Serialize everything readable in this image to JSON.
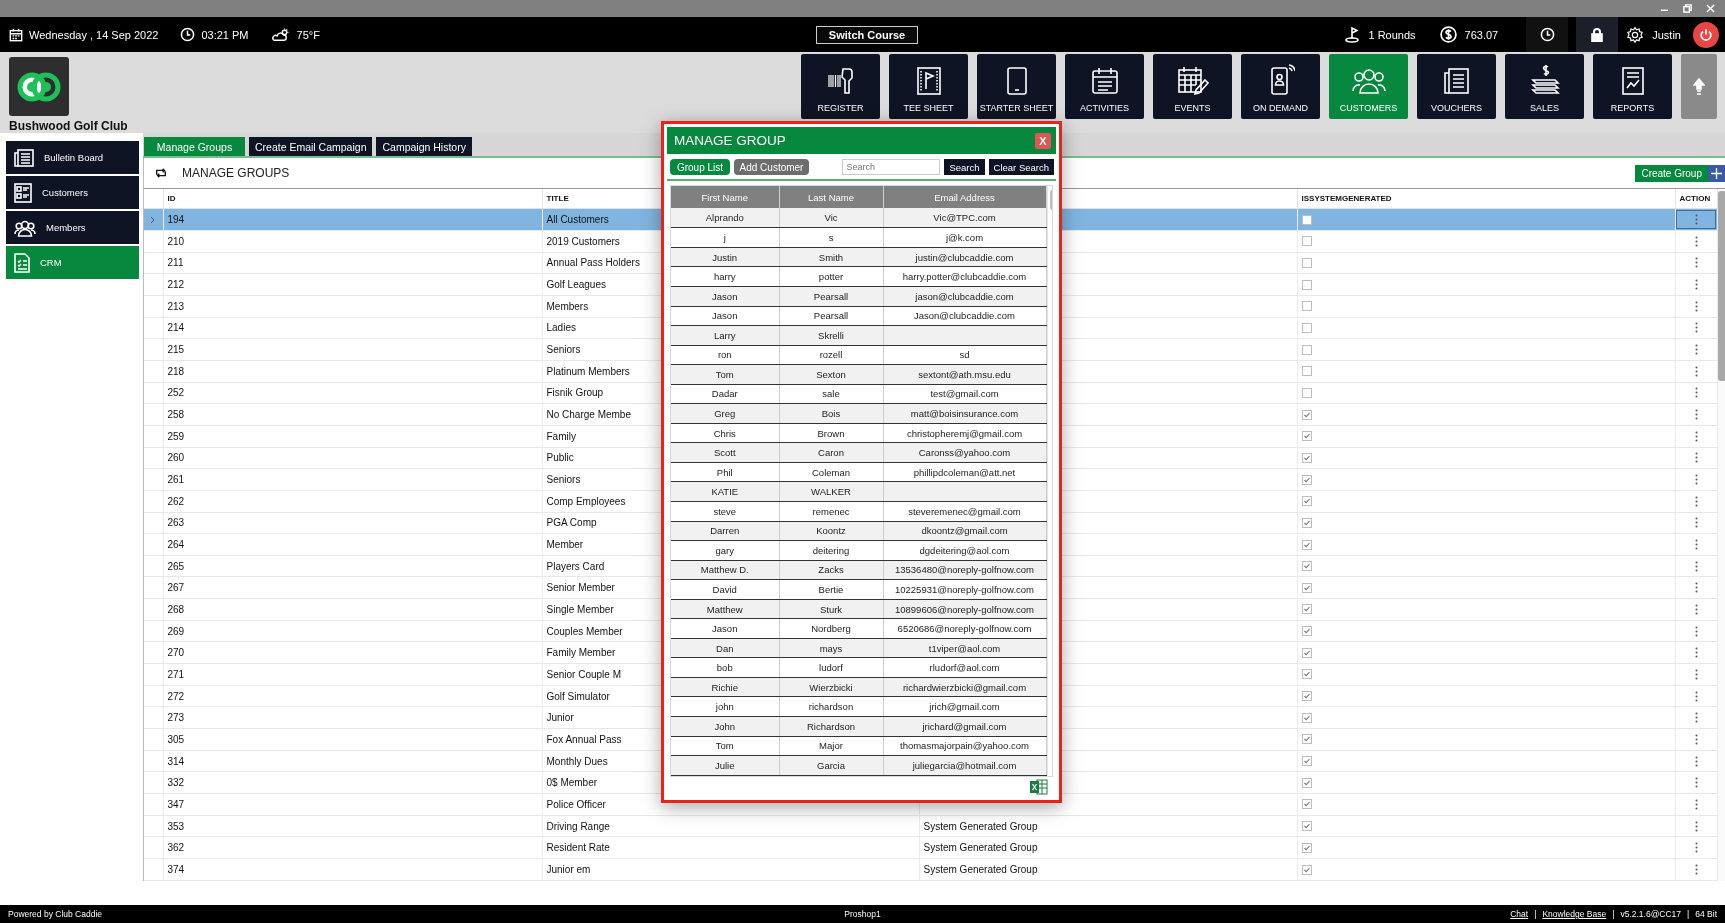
{
  "top_bar": {
    "date": "Wednesday ,  14 Sep 2022",
    "time": "03:21 PM",
    "weather": "75°F",
    "switch_course": "Switch Course",
    "rounds": "1 Rounds",
    "balance": "763.07",
    "user": "Justin"
  },
  "club": {
    "name": "Bushwood Golf Club"
  },
  "nav_tiles": [
    {
      "label": "REGISTER",
      "selected": false
    },
    {
      "label": "TEE SHEET",
      "selected": false
    },
    {
      "label": "STARTER SHEET",
      "selected": false
    },
    {
      "label": "ACTIVITIES",
      "selected": false
    },
    {
      "label": "EVENTS",
      "selected": false
    },
    {
      "label": "ON DEMAND",
      "selected": false
    },
    {
      "label": "CUSTOMERS",
      "selected": true
    },
    {
      "label": "VOUCHERS",
      "selected": false
    },
    {
      "label": "SALES",
      "selected": false
    },
    {
      "label": "REPORTS",
      "selected": false
    }
  ],
  "sidebar": {
    "items": [
      {
        "label": "Bulletin Board",
        "selected": false
      },
      {
        "label": "Customers",
        "selected": false
      },
      {
        "label": "Members",
        "selected": false
      },
      {
        "label": "CRM",
        "selected": true
      }
    ]
  },
  "tabs": [
    {
      "label": "Manage Groups",
      "selected": true
    },
    {
      "label": "Create Email Campaign",
      "selected": false
    },
    {
      "label": "Campaign History",
      "selected": false
    }
  ],
  "content": {
    "title": "MANAGE GROUPS",
    "create_button": "Create Group"
  },
  "table": {
    "columns": [
      "ID",
      "TITLE",
      "ISSYSTEMGENERATED",
      "ACTION"
    ],
    "rows": [
      {
        "id": "194",
        "title": "All Customers",
        "system_generated": false,
        "selected": true
      },
      {
        "id": "210",
        "title": "2019 Customers",
        "system_generated": false,
        "selected": false
      },
      {
        "id": "211",
        "title": "Annual Pass Holders",
        "system_generated": false,
        "selected": false
      },
      {
        "id": "212",
        "title": "Golf Leagues",
        "system_generated": false,
        "selected": false
      },
      {
        "id": "213",
        "title": "Members",
        "system_generated": false,
        "selected": false
      },
      {
        "id": "214",
        "title": "Ladies",
        "system_generated": false,
        "selected": false
      },
      {
        "id": "215",
        "title": "Seniors",
        "system_generated": false,
        "selected": false
      },
      {
        "id": "218",
        "title": "Platinum Members",
        "system_generated": false,
        "selected": false
      },
      {
        "id": "252",
        "title": "Fisnik Group",
        "system_generated": false,
        "selected": false
      },
      {
        "id": "258",
        "title": "No Charge Membe",
        "system_generated": true,
        "selected": false
      },
      {
        "id": "259",
        "title": "Family",
        "system_generated": true,
        "selected": false
      },
      {
        "id": "260",
        "title": "Public",
        "system_generated": true,
        "selected": false
      },
      {
        "id": "261",
        "title": "Seniors",
        "system_generated": true,
        "selected": false
      },
      {
        "id": "262",
        "title": "Comp Employees",
        "system_generated": true,
        "selected": false
      },
      {
        "id": "263",
        "title": "PGA Comp",
        "system_generated": true,
        "selected": false
      },
      {
        "id": "264",
        "title": "Member",
        "system_generated": true,
        "selected": false
      },
      {
        "id": "265",
        "title": "Players Card",
        "system_generated": true,
        "selected": false
      },
      {
        "id": "267",
        "title": "Senior Member",
        "system_generated": true,
        "selected": false
      },
      {
        "id": "268",
        "title": "Single Member",
        "system_generated": true,
        "selected": false
      },
      {
        "id": "269",
        "title": "Couples Member",
        "system_generated": true,
        "selected": false
      },
      {
        "id": "270",
        "title": "Family Member",
        "system_generated": true,
        "selected": false
      },
      {
        "id": "271",
        "title": "Senior Couple M",
        "system_generated": true,
        "selected": false
      },
      {
        "id": "272",
        "title": "Golf Simulator",
        "system_generated": true,
        "selected": false
      },
      {
        "id": "273",
        "title": "Junior",
        "system_generated": true,
        "selected": false
      },
      {
        "id": "305",
        "title": "Fox Annual Pass",
        "system_generated": true,
        "selected": false
      },
      {
        "id": "314",
        "title": "Monthly Dues",
        "system_generated": true,
        "selected": false
      },
      {
        "id": "332",
        "title": "0$ Member",
        "system_generated": true,
        "selected": false
      },
      {
        "id": "347",
        "title": "Police Officer",
        "system_generated": true,
        "selected": false
      },
      {
        "id": "353",
        "title": "Driving Range",
        "column_3": "System Generated Group",
        "system_generated": true,
        "selected": false
      },
      {
        "id": "362",
        "title": "Resident Rate",
        "column_3": "System Generated Group",
        "system_generated": true,
        "selected": false
      },
      {
        "id": "374",
        "title": "Junior em",
        "column_3": "System Generated Group",
        "system_generated": true,
        "selected": false
      }
    ]
  },
  "modal": {
    "title": "MANAGE GROUP",
    "close": "X",
    "tabs": [
      {
        "label": "Group List",
        "selected": true
      },
      {
        "label": "Add Customer",
        "selected": false
      }
    ],
    "search_placeholder": "Search",
    "search_button": "Search",
    "clear_button": "Clear Search",
    "columns": [
      "First Name",
      "Last Name",
      "Email Address"
    ],
    "rows": [
      {
        "first": "Alprando",
        "last": "Vic",
        "email": "Vic@TPC.com"
      },
      {
        "first": "j",
        "last": "s",
        "email": "j@k.com"
      },
      {
        "first": "Justin",
        "last": "Smith",
        "email": "justin@clubcaddie.com"
      },
      {
        "first": "harry",
        "last": "potter",
        "email": "harry.potter@clubcaddie.com"
      },
      {
        "first": "Jason",
        "last": "Pearsall",
        "email": "jason@clubcaddie.com"
      },
      {
        "first": "Jason",
        "last": "Pearsall",
        "email": "Jason@clubcaddie.com"
      },
      {
        "first": "Larry",
        "last": "Skrelli"
      },
      {
        "first": "ron",
        "last": "rozell",
        "email": "sd"
      },
      {
        "first": "Tom",
        "last": "Sexton",
        "email": "sextont@ath.msu.edu"
      },
      {
        "first": "Dadar",
        "last": "sale",
        "email": "test@gmail.com"
      },
      {
        "first": "Greg",
        "last": "Bois",
        "email": "matt@boisinsurance.com"
      },
      {
        "first": "Chris",
        "last": "Brown",
        "email": "christopheremj@gmail.com"
      },
      {
        "first": "Scott",
        "last": "Caron",
        "email": "Caronss@yahoo.com"
      },
      {
        "first": "Phil",
        "last": "Coleman",
        "email": "phillipdcoleman@att.net"
      },
      {
        "first": "KATIE",
        "last": "WALKER"
      },
      {
        "first": "steve",
        "last": "remenec",
        "email": "steveremenec@gmail.com"
      },
      {
        "first": "Darren",
        "last": "Koontz",
        "email": "dkoontz@gmail.com"
      },
      {
        "first": "gary",
        "last": "deitering",
        "email": "dgdeitering@aol.com"
      },
      {
        "first": "Matthew D.",
        "last": "Zacks",
        "email": "13536480@noreply-golfnow.com"
      },
      {
        "first": "David",
        "last": "Bertie",
        "email": "10225931@noreply-golfnow.com"
      },
      {
        "first": "Matthew",
        "last": "Sturk",
        "email": "10899606@noreply-golfnow.com"
      },
      {
        "first": "Jason",
        "last": "Nordberg",
        "email": "6520686@noreply-golfnow.com"
      },
      {
        "first": "Dan",
        "last": "mays",
        "email": "t1viper@aol.com"
      },
      {
        "first": "bob",
        "last": "ludorf",
        "email": "rludorf@aol.com"
      },
      {
        "first": "Richie",
        "last": "Wierzbicki",
        "email": "richardwierzbicki@gmail.com"
      },
      {
        "first": "john",
        "last": "richardson",
        "email": "jrich@gmail.com"
      },
      {
        "first": "John",
        "last": "Richardson",
        "email": "jrichard@gmail.com"
      },
      {
        "first": "Tom",
        "last": "Major",
        "email": "thomasmajorpain@yahoo.com"
      },
      {
        "first": "Julie",
        "last": "Garcia",
        "email": "juliegarcia@hotmail.com"
      }
    ]
  },
  "status_bar": {
    "left": "Powered by Club Caddie",
    "center": "Proshop1",
    "right": [
      {
        "kind": "link",
        "text": "Chat"
      },
      {
        "kind": "sep",
        "text": "|"
      },
      {
        "kind": "link",
        "text": "Knowledge Base"
      },
      {
        "kind": "sep",
        "text": "|"
      },
      {
        "kind": "text",
        "text": "v5.2.1.6@CC17"
      },
      {
        "kind": "sep",
        "text": "|"
      },
      {
        "kind": "text",
        "text": "64 Bit"
      }
    ]
  }
}
